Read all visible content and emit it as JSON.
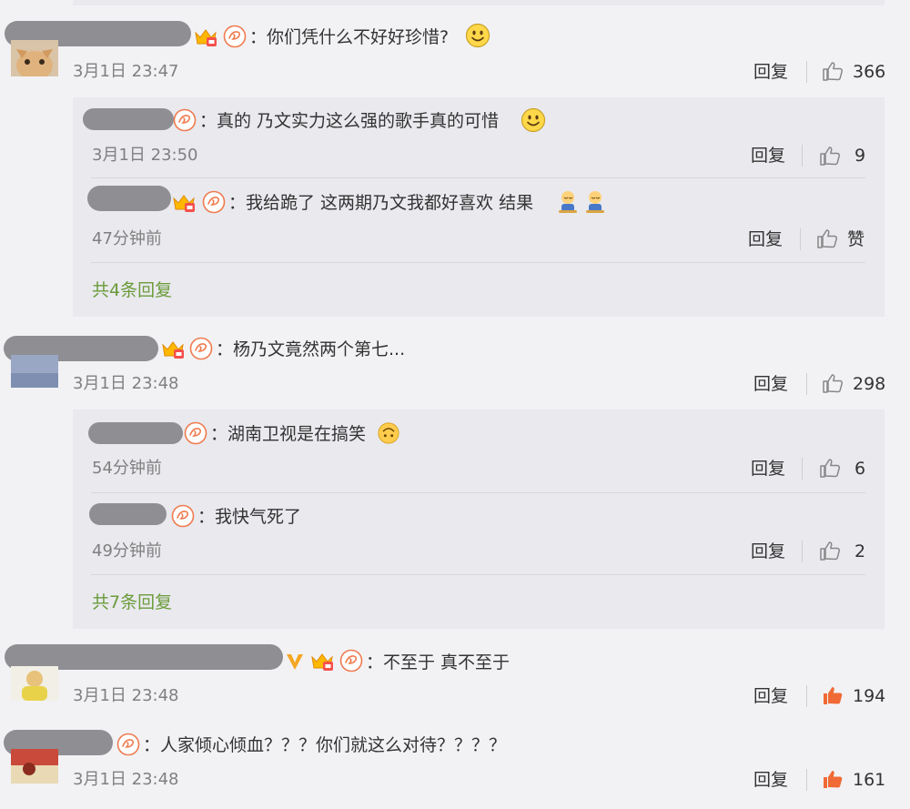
{
  "comments": [
    {
      "text": "：你们凭什么不好好珍惜?",
      "time": "3月1日 23:47",
      "reply_label": "回复",
      "likes": "366",
      "replies": [
        {
          "text": "：真的 乃文实力这么强的歌手真的可惜",
          "time": "3月1日 23:50",
          "reply_label": "回复",
          "likes": "9"
        },
        {
          "text": "：我给跪了 这两期乃文我都好喜欢 结果",
          "time": "47分钟前",
          "reply_label": "回复",
          "likes": "赞"
        }
      ],
      "more": "共4条回复"
    },
    {
      "text": "：杨乃文竟然两个第七...",
      "time": "3月1日 23:48",
      "reply_label": "回复",
      "likes": "298",
      "replies": [
        {
          "text": "：湖南卫视是在搞笑",
          "time": "54分钟前",
          "reply_label": "回复",
          "likes": "6"
        },
        {
          "text": "：我快气死了",
          "time": "49分钟前",
          "reply_label": "回复",
          "likes": "2"
        }
      ],
      "more": "共7条回复"
    },
    {
      "text": "：不至于 真不至于",
      "time": "3月1日 23:48",
      "reply_label": "回复",
      "likes": "194"
    },
    {
      "text": "：人家倾心倾血？？？你们就这么对待？？？？",
      "time": "3月1日 23:48",
      "reply_label": "回复",
      "likes": "161"
    }
  ],
  "colors": {
    "background": "#f2f2f5",
    "panel": "#e9e9ee",
    "more_link": "#6b9b3a",
    "liked": "#f06a35"
  },
  "icons": [
    "smile-emoji-icon",
    "kneel-emoji-icon",
    "upside-down-emoji-icon",
    "crown-badge-icon",
    "fan-badge-icon",
    "verified-v-icon",
    "thumbs-up-icon"
  ]
}
